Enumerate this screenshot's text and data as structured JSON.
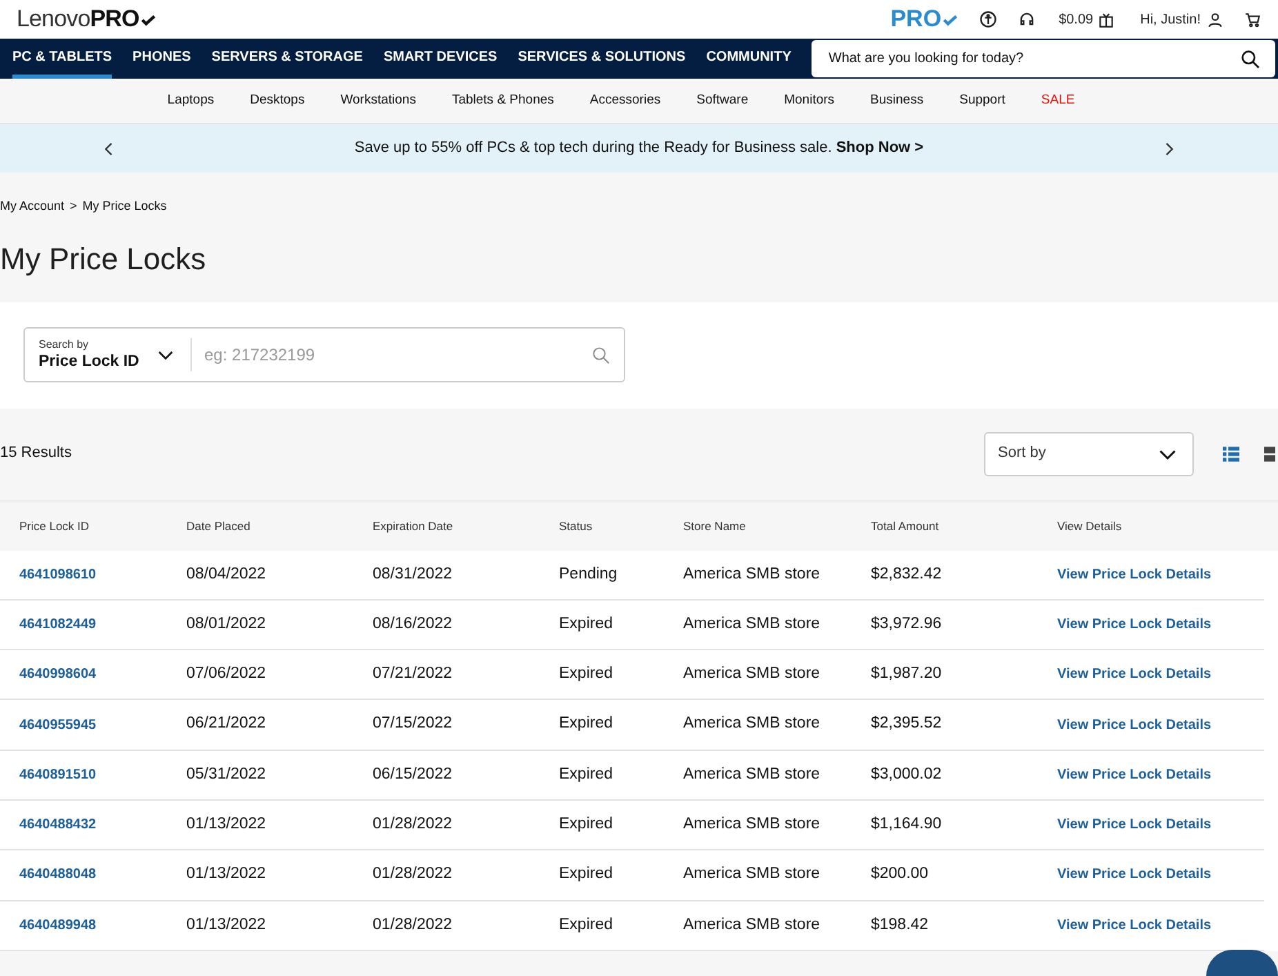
{
  "header": {
    "logo": {
      "text": "Lenovo",
      "bold": "PRO"
    },
    "pro_badge": "PRO",
    "balance": "$0.09",
    "greeting": "Hi, Justin!"
  },
  "nav": {
    "items": [
      {
        "label": "PC & TABLETS",
        "selected": true
      },
      {
        "label": "PHONES",
        "selected": false
      },
      {
        "label": "SERVERS & STORAGE",
        "selected": false
      },
      {
        "label": "SMART DEVICES",
        "selected": false
      },
      {
        "label": "SERVICES & SOLUTIONS",
        "selected": false
      },
      {
        "label": "COMMUNITY",
        "selected": false
      }
    ],
    "search": {
      "placeholder": "What are you looking for today?"
    }
  },
  "subnav": [
    {
      "label": "Laptops",
      "kind": "normal"
    },
    {
      "label": "Desktops",
      "kind": "normal"
    },
    {
      "label": "Workstations",
      "kind": "normal"
    },
    {
      "label": "Tablets & Phones",
      "kind": "normal"
    },
    {
      "label": "Accessories",
      "kind": "normal"
    },
    {
      "label": "Software",
      "kind": "normal"
    },
    {
      "label": "Monitors",
      "kind": "normal"
    },
    {
      "label": "Business",
      "kind": "normal"
    },
    {
      "label": "Support",
      "kind": "normal"
    },
    {
      "label": "SALE",
      "kind": "sale"
    }
  ],
  "banner": {
    "text": "Save up to 55% off PCs & top tech during the Ready for Business sale. **Shop Now >**"
  },
  "breadcrumb": [
    "My Account",
    ">",
    "My Price Locks"
  ],
  "title": "My Price Locks",
  "search": {
    "label": "Search by",
    "value": "Price Lock ID",
    "placeholder": "eg: 217232199"
  },
  "results": {
    "count": "15 Results",
    "sort_placeholder": "Sort by"
  },
  "table": {
    "columns": [
      "Price Lock ID",
      "Date Placed",
      "Expiration Date",
      "Status",
      "Store Name",
      "Total Amount",
      "View Details"
    ],
    "rows": [
      [
        "4641098610",
        "08/04/2022",
        "08/31/2022",
        "Pending",
        "America SMB store",
        "$2,832.42",
        "View Price Lock Details"
      ],
      [
        "4641082449",
        "08/01/2022",
        "08/16/2022",
        "Expired",
        "America SMB store",
        "$3,972.96",
        "View Price Lock Details"
      ],
      [
        "4640998604",
        "07/06/2022",
        "07/21/2022",
        "Expired",
        "America SMB store",
        "$1,987.20",
        "View Price Lock Details"
      ],
      [
        "4640955945",
        "06/21/2022",
        "07/15/2022",
        "Expired",
        "America SMB store",
        "$2,395.52",
        "View Price Lock Details"
      ],
      [
        "4640891510",
        "05/31/2022",
        "06/15/2022",
        "Expired",
        "America SMB store",
        "$3,000.02",
        "View Price Lock Details"
      ],
      [
        "4640488432",
        "01/13/2022",
        "01/28/2022",
        "Expired",
        "America SMB store",
        "$1,164.90",
        "View Price Lock Details"
      ],
      [
        "4640488048",
        "01/13/2022",
        "01/28/2022",
        "Expired",
        "America SMB store",
        "$200.00",
        "View Price Lock Details"
      ],
      [
        "4640489948",
        "01/13/2022",
        "01/28/2022",
        "Expired",
        "America SMB store",
        "$198.42",
        "View Price Lock Details"
      ]
    ]
  }
}
